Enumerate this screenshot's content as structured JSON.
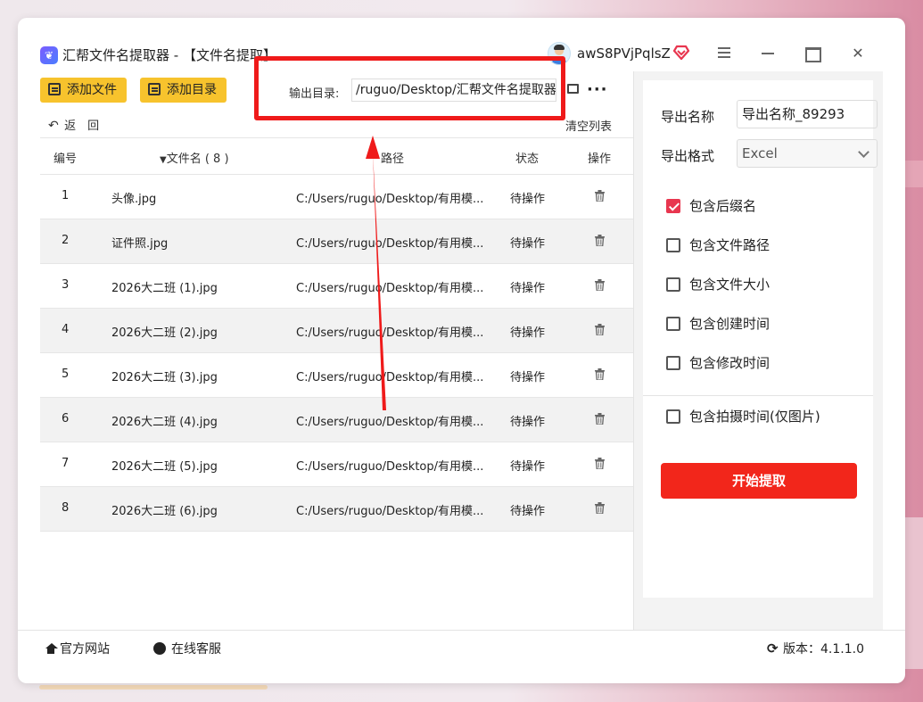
{
  "window": {
    "title": "汇帮文件名提取器 - 【文件名提取】",
    "username": "awS8PVjPqlsZ"
  },
  "toolbar": {
    "add_file": "添加文件",
    "add_dir": "添加目录",
    "output_label": "输出目录:",
    "output_path": "/ruguo/Desktop/汇帮文件名提取器",
    "back": "返　回",
    "clear_list": "清空列表"
  },
  "table": {
    "headers": {
      "index": "编号",
      "name": "文件名 ( 8 )",
      "path": "路径",
      "status": "状态",
      "action": "操作"
    },
    "rows": [
      {
        "index": "1",
        "name": "头像.jpg",
        "path": "C:/Users/ruguo/Desktop/有用模...",
        "status": "待操作"
      },
      {
        "index": "2",
        "name": "证件照.jpg",
        "path": "C:/Users/ruguo/Desktop/有用模...",
        "status": "待操作"
      },
      {
        "index": "3",
        "name": "2026大二班 (1).jpg",
        "path": "C:/Users/ruguo/Desktop/有用模...",
        "status": "待操作"
      },
      {
        "index": "4",
        "name": "2026大二班 (2).jpg",
        "path": "C:/Users/ruguo/Desktop/有用模...",
        "status": "待操作"
      },
      {
        "index": "5",
        "name": "2026大二班 (3).jpg",
        "path": "C:/Users/ruguo/Desktop/有用模...",
        "status": "待操作"
      },
      {
        "index": "6",
        "name": "2026大二班 (4).jpg",
        "path": "C:/Users/ruguo/Desktop/有用模...",
        "status": "待操作"
      },
      {
        "index": "7",
        "name": "2026大二班 (5).jpg",
        "path": "C:/Users/ruguo/Desktop/有用模...",
        "status": "待操作"
      },
      {
        "index": "8",
        "name": "2026大二班 (6).jpg",
        "path": "C:/Users/ruguo/Desktop/有用模...",
        "status": "待操作"
      }
    ]
  },
  "panel": {
    "export_name_label": "导出名称",
    "export_name_value": "导出名称_89293",
    "export_format_label": "导出格式",
    "export_format_value": "Excel",
    "options": [
      {
        "label": "包含后缀名",
        "checked": true
      },
      {
        "label": "包含文件路径",
        "checked": false
      },
      {
        "label": "包含文件大小",
        "checked": false
      },
      {
        "label": "包含创建时间",
        "checked": false
      },
      {
        "label": "包含修改时间",
        "checked": false
      },
      {
        "label": "包含拍摄时间(仅图片)",
        "checked": false
      }
    ],
    "start": "开始提取"
  },
  "footer": {
    "website": "官方网站",
    "service": "在线客服",
    "version": "版本：4.1.1.0"
  },
  "colors": {
    "accent_yellow": "#f7c32d",
    "start_red": "#f2261b",
    "checkbox_red": "#e8364f",
    "annotation_red": "#ef1a1a"
  }
}
